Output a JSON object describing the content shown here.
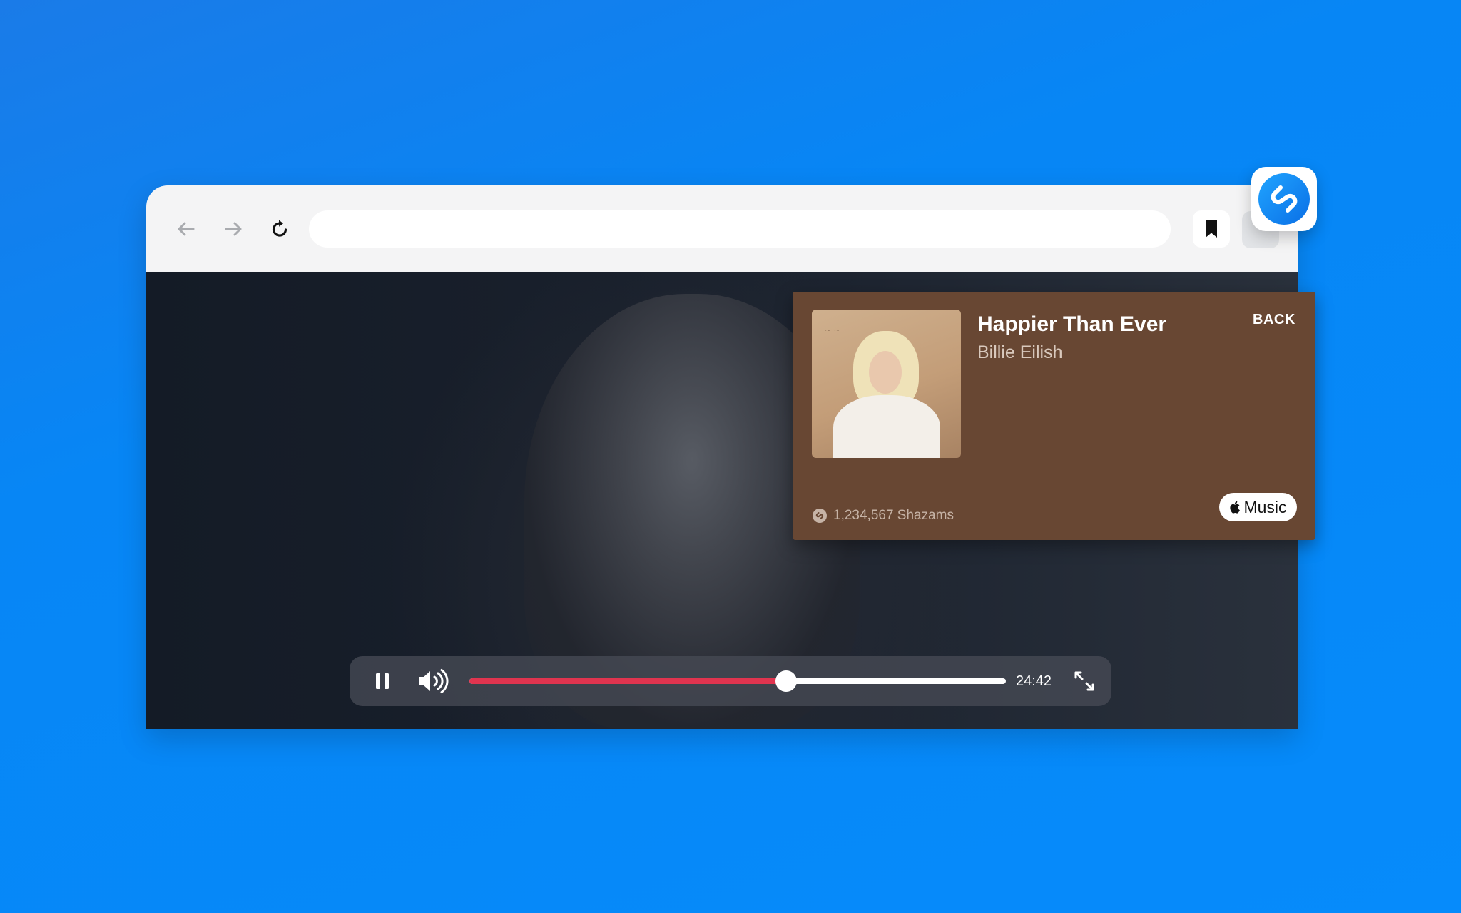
{
  "player": {
    "time": "24:42",
    "progress": 0.59
  },
  "now_playing": {
    "title": "Happier Than Ever",
    "artist": "Billie Eilish",
    "back_label": "BACK",
    "shazam_count": "1,234,567 Shazams",
    "apple_music_label": "Music"
  },
  "colors": {
    "background": "#068bfb",
    "popup": "#684733",
    "progress_fill": "#e0344f",
    "shazam_blue": "#0b8cfc"
  },
  "icons": {
    "back": "arrow-left-icon",
    "forward": "arrow-right-icon",
    "reload": "reload-icon",
    "bookmark": "bookmark-icon",
    "pause": "pause-icon",
    "volume": "volume-icon",
    "fullscreen": "fullscreen-icon",
    "apple": "apple-logo-icon",
    "shazam": "shazam-logo-icon"
  }
}
